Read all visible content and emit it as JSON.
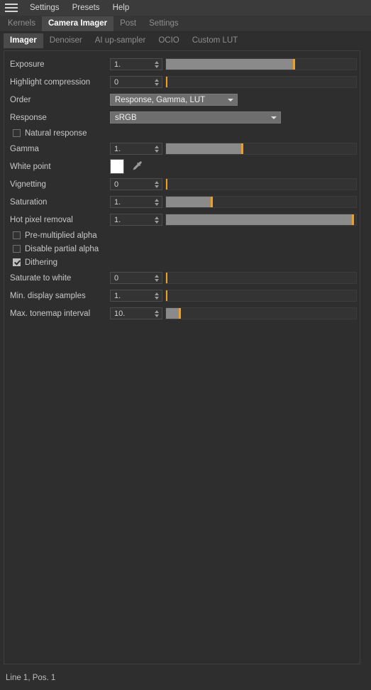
{
  "menubar": {
    "hamburger_icon": "hamburger-menu-icon",
    "items": [
      {
        "label": "Settings"
      },
      {
        "label": "Presets"
      },
      {
        "label": "Help"
      }
    ]
  },
  "tabs": [
    {
      "label": "Kernels",
      "active": false
    },
    {
      "label": "Camera Imager",
      "active": true
    },
    {
      "label": "Post",
      "active": false
    },
    {
      "label": "Settings",
      "active": false
    }
  ],
  "subtabs": [
    {
      "label": "Imager",
      "active": true
    },
    {
      "label": "Denoiser",
      "active": false
    },
    {
      "label": "AI up-sampler",
      "active": false
    },
    {
      "label": "OCIO",
      "active": false
    },
    {
      "label": "Custom LUT",
      "active": false
    }
  ],
  "colors": {
    "accent": "#f0a020",
    "panel_bg": "#2e2e2e",
    "field_bg": "#333333",
    "slider_fill": "#8a8a8a",
    "dropdown_bg": "#6e6e6e",
    "white_point_swatch": "#ffffff"
  },
  "params": {
    "exposure": {
      "label": "Exposure",
      "value": "1.",
      "slider_fill_pct": 67,
      "slider_handle_pct": 67
    },
    "highlight_compression": {
      "label": "Highlight compression",
      "value": "0",
      "slider_fill_pct": 0,
      "slider_handle_pct": 0
    },
    "order": {
      "label": "Order",
      "value": "Response, Gamma, LUT",
      "icon": "chevron-down-icon"
    },
    "response": {
      "label": "Response",
      "value": "sRGB",
      "icon": "chevron-down-icon"
    },
    "natural_response": {
      "label": "Natural response",
      "checked": false
    },
    "gamma": {
      "label": "Gamma",
      "value": "1.",
      "slider_fill_pct": 40,
      "slider_handle_pct": 40
    },
    "white_point": {
      "label": "White point",
      "swatch_color": "#ffffff",
      "picker_icon": "eyedropper-icon"
    },
    "vignetting": {
      "label": "Vignetting",
      "value": "0",
      "slider_fill_pct": 0,
      "slider_handle_pct": 0
    },
    "saturation": {
      "label": "Saturation",
      "value": "1.",
      "slider_fill_pct": 24,
      "slider_handle_pct": 24
    },
    "hot_pixel_removal": {
      "label": "Hot pixel removal",
      "value": "1.",
      "slider_fill_pct": 98,
      "slider_handle_pct": 98
    },
    "pre_multiplied_alpha": {
      "label": "Pre-multiplied alpha",
      "checked": false
    },
    "disable_partial_alpha": {
      "label": "Disable partial alpha",
      "checked": false
    },
    "dithering": {
      "label": "Dithering",
      "checked": true
    },
    "saturate_to_white": {
      "label": "Saturate to white",
      "value": "0",
      "slider_fill_pct": 0,
      "slider_handle_pct": 0
    },
    "min_display_samples": {
      "label": "Min. display samples",
      "value": "1.",
      "slider_fill_pct": 0,
      "slider_handle_pct": 0
    },
    "max_tonemap_interval": {
      "label": "Max. tonemap interval",
      "value": "10.",
      "slider_fill_pct": 7,
      "slider_handle_pct": 7
    }
  },
  "statusbar": {
    "text": "Line 1, Pos. 1"
  }
}
